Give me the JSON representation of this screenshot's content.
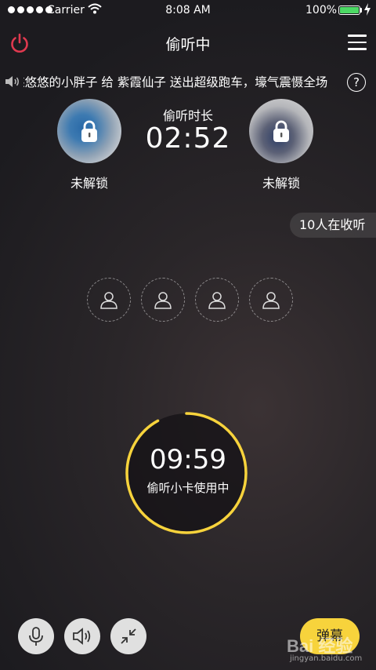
{
  "status_bar": {
    "carrier": "Carrier",
    "time": "8:08 AM",
    "battery": "100%",
    "battery_color": "#4cd964"
  },
  "nav": {
    "title": "偷听中",
    "power_icon": "power-icon",
    "menu_icon": "menu-icon",
    "power_color": "#e0394f"
  },
  "marquee": {
    "text": "悠悠悠的小胖子 给 紫霞仙子 送出超级跑车，壕气震慑全场",
    "help": "?"
  },
  "left_user": {
    "lock_label": "未解锁"
  },
  "right_user": {
    "lock_label": "未解锁"
  },
  "listen": {
    "label": "偷听时长",
    "duration": "02:52"
  },
  "listeners": "10人在收听",
  "seats": [
    {
      "icon": "user-icon"
    },
    {
      "icon": "user-icon"
    },
    {
      "icon": "user-icon"
    },
    {
      "icon": "user-icon"
    }
  ],
  "timer": {
    "time": "09:59",
    "label": "偷听小卡使用中",
    "progress": 0.92,
    "ring_color": "#f7d33c"
  },
  "bottom_bar": {
    "buttons": [
      "microphone-icon",
      "speaker-icon",
      "minimize-icon"
    ],
    "danmu_label": "弹幕",
    "danmu_color": "#f7d33c"
  },
  "watermark": {
    "logo": "Bai 经验",
    "url": "jingyan.baidu.com"
  }
}
